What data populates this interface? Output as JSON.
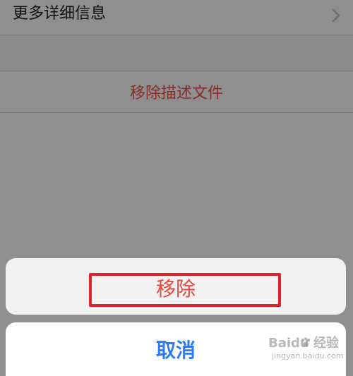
{
  "settings": {
    "more_info_label": "更多详细信息",
    "remove_profile_label": "移除描述文件"
  },
  "action_sheet": {
    "remove_label": "移除",
    "cancel_label": "取消"
  },
  "watermark": {
    "brand": "Baidu 经验",
    "sub": "jingyan.baidu.com"
  },
  "colors": {
    "destructive": "#e9453b",
    "cancel": "#2d7cf6",
    "highlight": "#e0232b"
  },
  "icons": {
    "chevron": "chevron-right-icon",
    "watermark": "baidu-paw-icon"
  }
}
